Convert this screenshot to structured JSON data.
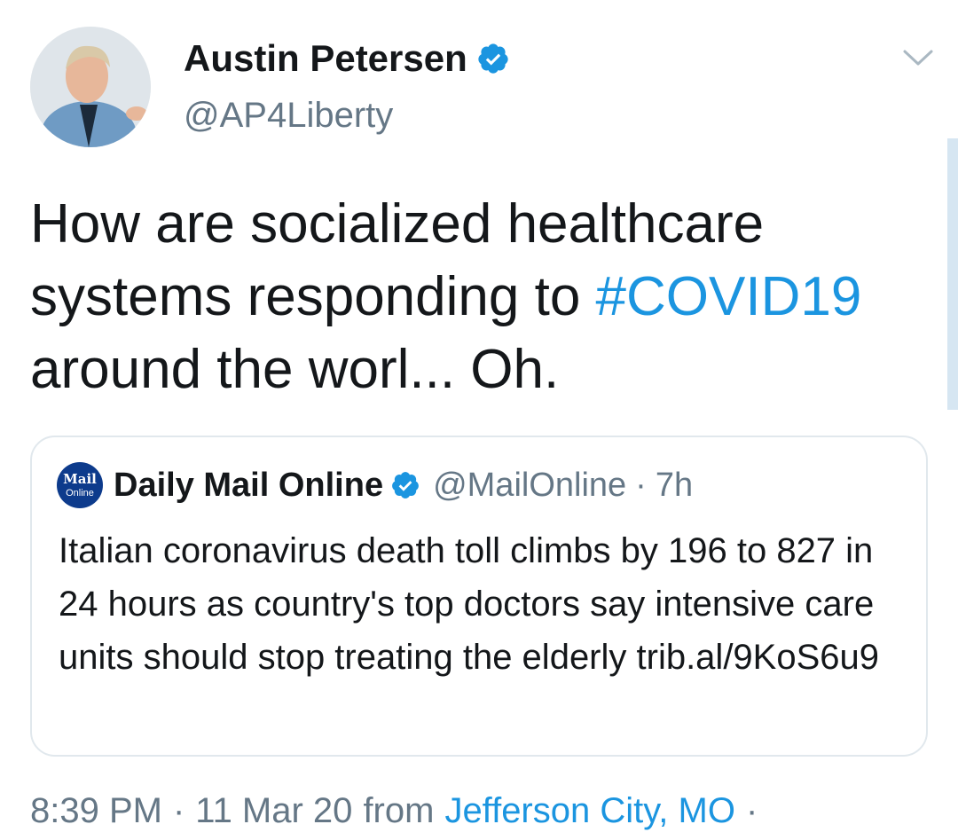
{
  "tweet": {
    "author": {
      "name": "Austin Petersen",
      "handle": "@AP4Liberty",
      "verified": true
    },
    "text_before_hashtag": "How are socialized healthcare systems responding to",
    "hashtag": "#COVID19",
    "text_after_hashtag": "around the worl... Oh.",
    "timestamp": "8:39 PM",
    "date": "11 Mar 20",
    "from_label": "from",
    "location": "Jefferson City, MO",
    "separator": "·"
  },
  "quoted_tweet": {
    "logo_line1": "Mail",
    "logo_line2": "Online",
    "name": "Daily Mail Online",
    "handle": "@MailOnline",
    "time": "7h",
    "separator": "·",
    "verified": true,
    "text": "Italian coronavirus death toll climbs by 196 to 827 in 24 hours as country's top doctors say intensive care units should stop treating the elderly trib.al/9KoS6u9"
  },
  "icons": {
    "verified": "verified-badge-icon",
    "caret": "chevron-down-icon"
  },
  "colors": {
    "link": "#1b95e0",
    "text": "#14171a",
    "muted": "#657786",
    "border": "#e1e8ed",
    "mail_logo": "#0d3b8c"
  }
}
